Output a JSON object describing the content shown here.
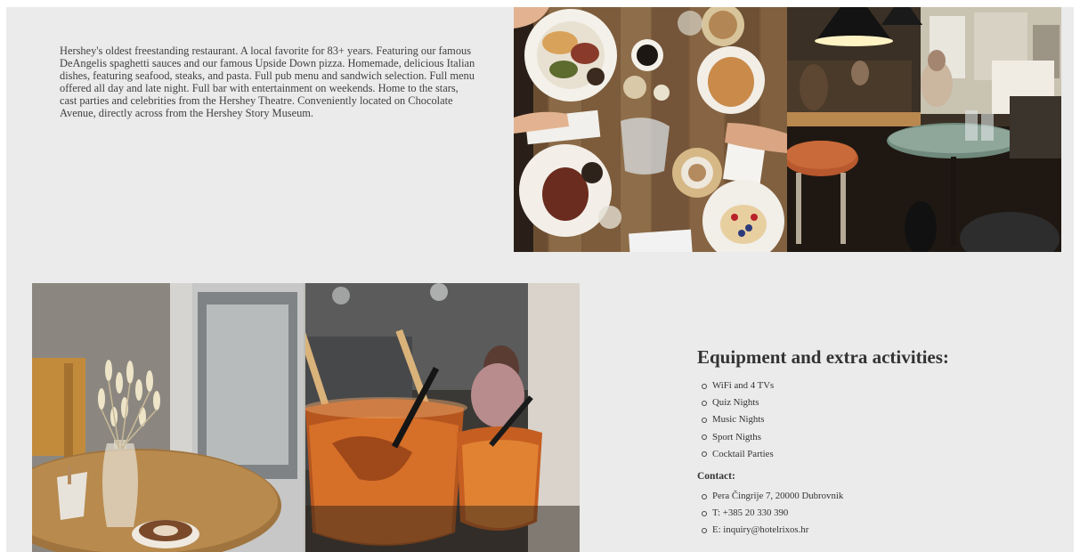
{
  "about": {
    "description": "Hershey's oldest freestanding restaurant. A local favorite for 83+ years. Featuring our famous DeAngelis spaghetti sauces and our famous Upside Down pizza. Homemade, delicious Italian dishes, featuring seafood, steaks, and pasta. Full pub menu and sandwich selection. Full menu offered all day and late night. Full bar with entertainment on weekends. Home to the stars, cast parties and celebrities from the Hershey Theatre. Conveniently located on Chocolate Avenue, directly across from the Hershey Story Museum."
  },
  "activities": {
    "title": "Equipment and extra activities:",
    "items": [
      "WiFi and 4 TVs",
      "Quiz Nights",
      "Music Nights",
      "Sport Nigths",
      "Cocktail Parties"
    ]
  },
  "contact": {
    "title": "Contact:",
    "items": [
      "Pera Čingrije 7, 20000 Dubrovnik",
      "T: +385 20 330 390",
      "E: inquiry@hotelrixos.hr"
    ]
  },
  "colors": {
    "background": "#ebebeb",
    "text": "#3f3f3f"
  }
}
